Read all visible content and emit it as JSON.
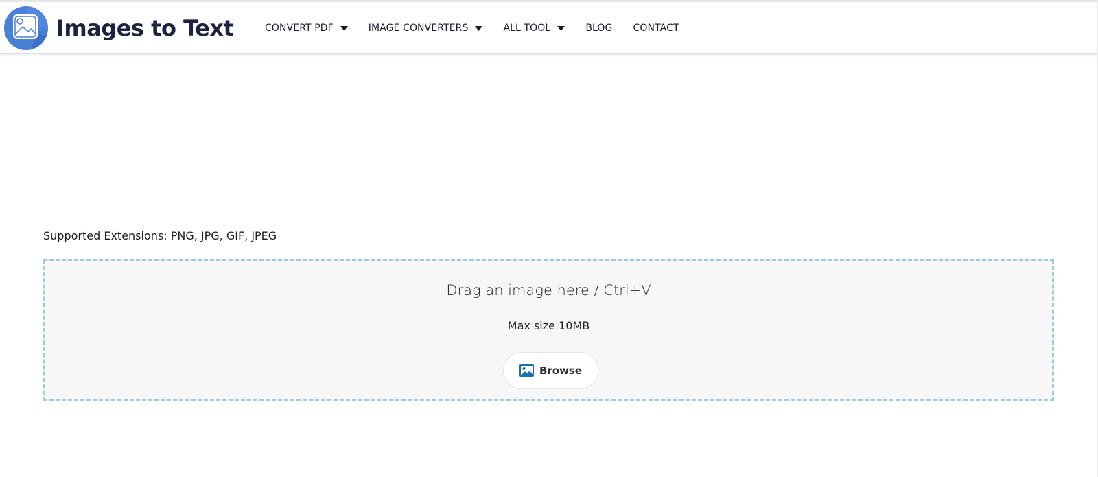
{
  "brand": {
    "name": "Images to Text",
    "logo_icon": "image-icon",
    "logo_color": "#4a7fd6"
  },
  "nav": {
    "items": [
      {
        "label": "CONVERT PDF",
        "has_dropdown": true
      },
      {
        "label": "IMAGE CONVERTERS",
        "has_dropdown": true
      },
      {
        "label": "ALL TOOL",
        "has_dropdown": true
      },
      {
        "label": "BLOG",
        "has_dropdown": false
      },
      {
        "label": "CONTACT",
        "has_dropdown": false
      }
    ]
  },
  "upload": {
    "supported_extensions": "Supported Extensions: PNG, JPG, GIF, JPEG",
    "drop_title": "Drag an image here / Ctrl+V",
    "max_size": "Max size 10MB",
    "browse_label": "Browse",
    "browse_icon": "image-icon",
    "accent_color": "#1a73a8",
    "dropzone_border_color": "#9ecbe0"
  }
}
